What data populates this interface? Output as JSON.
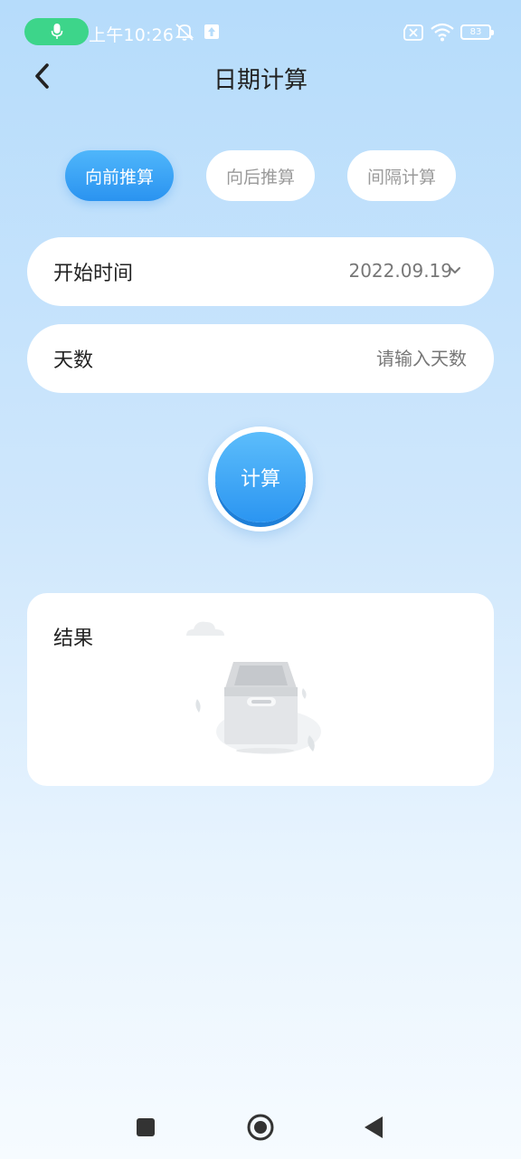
{
  "status_bar": {
    "time": "上午10:26",
    "battery": "83",
    "icons": [
      "mic-icon",
      "mute-bell-icon",
      "upload-icon",
      "sim-x-icon",
      "wifi-icon",
      "battery-icon"
    ]
  },
  "header": {
    "title": "日期计算",
    "back_icon": "chevron-left-icon"
  },
  "tabs": [
    {
      "label": "向前推算",
      "active": true
    },
    {
      "label": "向后推算",
      "active": false
    },
    {
      "label": "间隔计算",
      "active": false
    }
  ],
  "form": {
    "start_time_label": "开始时间",
    "start_time_value": "2022.09.19",
    "days_label": "天数",
    "days_placeholder": "请输入天数",
    "days_value": ""
  },
  "calc_button": {
    "label": "计算"
  },
  "result": {
    "label": "结果",
    "empty_icon": "empty-box-icon"
  },
  "nav_bar": {
    "icons": [
      "recent-apps-icon",
      "home-icon",
      "back-triangle-icon"
    ]
  },
  "colors": {
    "accent": "#2a93f0",
    "accent_light": "#4fb6fb",
    "mic_green": "#3dd58a",
    "inactive_tab_text": "#9a9a9a"
  }
}
